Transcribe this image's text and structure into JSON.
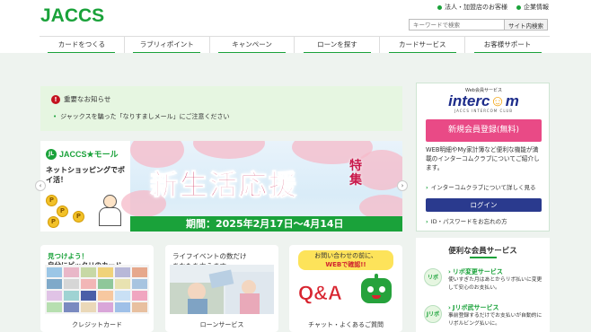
{
  "header": {
    "logo": "JACCS",
    "util_links": [
      "法人・加盟店のお客様",
      "企業情報"
    ],
    "search_placeholder": "キーワードで検索",
    "search_button": "サイト内検索"
  },
  "nav": [
    "カードをつくる",
    "ラブリィポイント",
    "キャンペーン",
    "ローンを探す",
    "カードサービス",
    "お客様サポート"
  ],
  "notice": {
    "title": "重要なお知らせ",
    "items": [
      "ジャックスを騙った「なりすましメール」にご注意ください"
    ]
  },
  "banner": {
    "mall_brand": "JACCS★モール",
    "mall_badge": "JL",
    "left_text": "ネットショッピングでポイ活！",
    "coin_label": "P",
    "headline": "新生活応援",
    "headline_sub": "特集",
    "period": "期間：2025年2月17日～4月14日",
    "prev": "‹",
    "next": "›"
  },
  "cards": [
    {
      "title_accent": "見つけよう！",
      "title": "自分にピッタリのカード",
      "caption": "クレジットカード"
    },
    {
      "title_line1": "ライフイベントの数だけ",
      "title_line2": "あなたを支えます",
      "caption": "ローンサービス"
    },
    {
      "bubble_line1": "お問い合わせの前に、",
      "bubble_line2": "WEBで確認!!",
      "qa": "Q&A",
      "caption": "チャット・よくあるご質問"
    }
  ],
  "sidebar": {
    "intercom_small": "Web会員サービス",
    "intercom_name_a": "interc",
    "intercom_name_o": "☺",
    "intercom_name_b": "m",
    "intercom_tiny": "JACCS INTERCOM CLUB",
    "register_button": "新規会員登録(無料)",
    "description": "WEB明細やMy家計簿など便利な機能が満載のインターコムクラブについてご紹介します。",
    "link_about": "インターコムクラブについて詳しく見る",
    "login_button": "ログイン",
    "link_forgot": "ID・パスワードをお忘れの方"
  },
  "services": {
    "title": "便利な会員サービス",
    "items": [
      {
        "icon": "リボ",
        "name": "リボ変更サービス",
        "desc": "使いすぎた月はあとからリボ払いに変更して安心のお支払い。"
      },
      {
        "icon": "Jリボ",
        "name": "Jリボ武サービス",
        "desc": "事前登録するだけでお支払いが自動的にリボルビング払いに。"
      }
    ]
  },
  "colors": {
    "brand_green": "#1aa23a",
    "pink": "#e94a86",
    "navy": "#2a3a8e",
    "red": "#c8174a"
  }
}
